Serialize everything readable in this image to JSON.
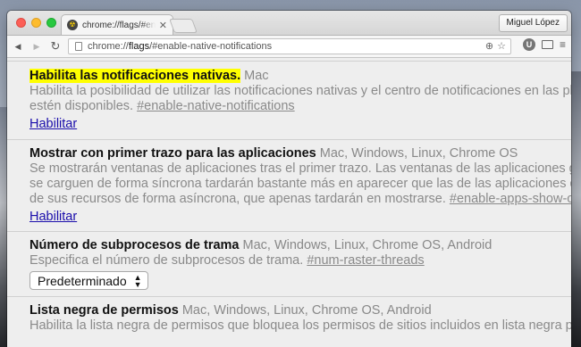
{
  "window": {
    "tab_title": "chrome://flags/#enable-native-notifications",
    "profile_name": "Miguel López",
    "url_prefix": "chrome://",
    "url_host": "flags",
    "url_rest": "/#enable-native-notifications"
  },
  "icons": {
    "back": "◀",
    "forward": "▶",
    "reload": "↻",
    "zoom": "⊕",
    "star": "☆",
    "ext": "U",
    "menu": "≡",
    "tab_close": "✕",
    "favicon": "☢"
  },
  "flags": [
    {
      "title": "Habilita las notificaciones nativas.",
      "highlighted": true,
      "platforms": "Mac",
      "desc_lines": [
        "Habilita la posibilidad de utilizar las notificaciones nativas y el centro de notificaciones en las platafo",
        "estén disponibles. "
      ],
      "flag_id": "#enable-native-notifications",
      "action": "Habilitar"
    },
    {
      "title": "Mostrar con primer trazo para las aplicaciones",
      "highlighted": false,
      "platforms": "Mac, Windows, Linux, Chrome OS",
      "desc_lines": [
        "Se mostrarán ventanas de aplicaciones tras el primer trazo. Las ventanas de las aplicaciones grande",
        "se carguen de forma síncrona tardarán bastante más en aparecer que las de las aplicaciones que ca",
        "de sus recursos de forma asíncrona, que apenas tardarán en mostrarse. "
      ],
      "flag_id": "#enable-apps-show-on-fir",
      "action": "Habilitar"
    },
    {
      "title": "Número de subprocesos de trama",
      "highlighted": false,
      "platforms": "Mac, Windows, Linux, Chrome OS, Android",
      "desc_lines": [
        "Especifica el número de subprocesos de trama. "
      ],
      "flag_id": "#num-raster-threads",
      "select_value": "Predeterminado"
    },
    {
      "title": "Lista negra de permisos",
      "highlighted": false,
      "platforms": "Mac, Windows, Linux, Chrome OS, Android",
      "desc_lines": [
        "Habilita la lista negra de permisos que bloquea los permisos de sitios incluidos en lista negra para u"
      ]
    }
  ]
}
